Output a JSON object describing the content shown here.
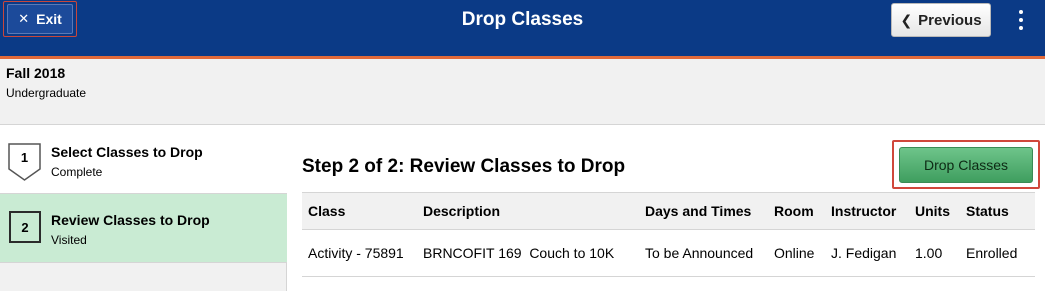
{
  "header": {
    "title": "Drop Classes",
    "exit_label": "Exit",
    "previous_label": "Previous",
    "colors": {
      "bar": "#0b3a86",
      "accent": "#e26a3a"
    }
  },
  "term": {
    "name": "Fall 2018",
    "career": "Undergraduate"
  },
  "steps": [
    {
      "number": "1",
      "title": "Select Classes to Drop",
      "status": "Complete"
    },
    {
      "number": "2",
      "title": "Review Classes to Drop",
      "status": "Visited"
    }
  ],
  "main": {
    "heading": "Step 2 of 2: Review Classes to Drop",
    "drop_button_label": "Drop Classes",
    "table": {
      "headers": [
        "Class",
        "Description",
        "Days and Times",
        "Room",
        "Instructor",
        "Units",
        "Status"
      ],
      "rows": [
        [
          "Activity - 75891",
          "BRNCOFIT 169  Couch to 10K",
          "To be Announced",
          "Online",
          "J. Fedigan",
          "1.00",
          "Enrolled"
        ]
      ]
    }
  },
  "icons": [
    "close-icon",
    "chevron-left-icon",
    "more-vertical-icon",
    "step-marker-icon"
  ]
}
